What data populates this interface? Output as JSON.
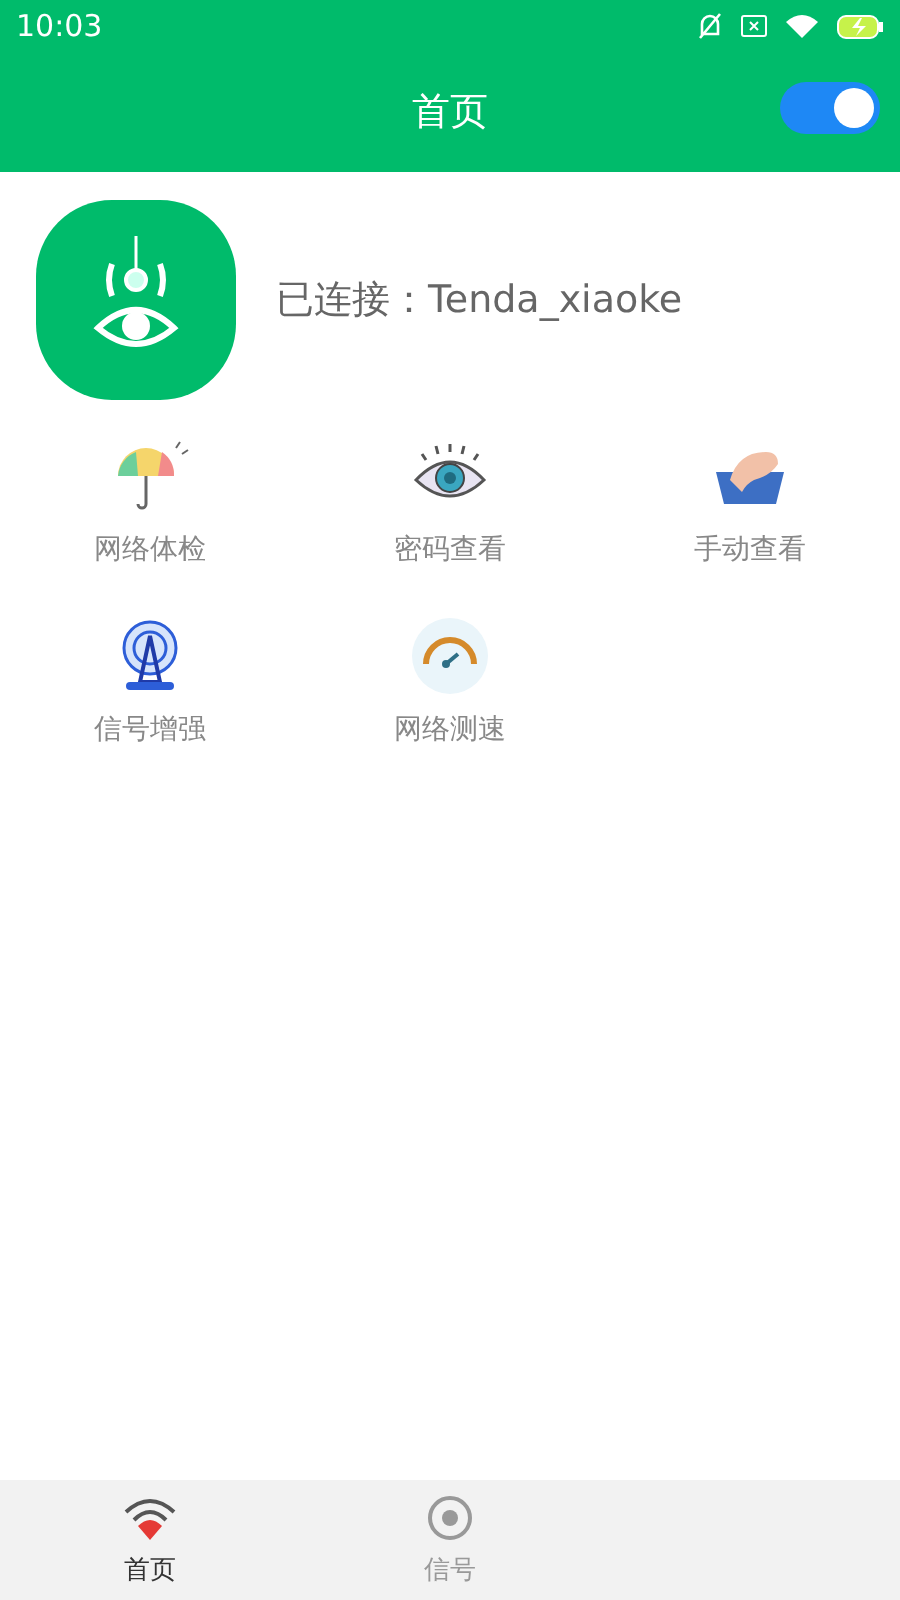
{
  "status_bar": {
    "time": "10:03"
  },
  "header": {
    "title": "首页",
    "toggle_on": true
  },
  "connection": {
    "text": "已连接：Tenda_xiaoke"
  },
  "tools": [
    {
      "label": "网络体检",
      "kind": "umbrella"
    },
    {
      "label": "密码查看",
      "kind": "eye"
    },
    {
      "label": "手动查看",
      "kind": "hand"
    },
    {
      "label": "信号增强",
      "kind": "tower"
    },
    {
      "label": "网络测速",
      "kind": "gauge"
    }
  ],
  "tabs": [
    {
      "label": "首页",
      "kind": "wifi",
      "selected": true
    },
    {
      "label": "信号",
      "kind": "signal",
      "selected": false
    }
  ]
}
